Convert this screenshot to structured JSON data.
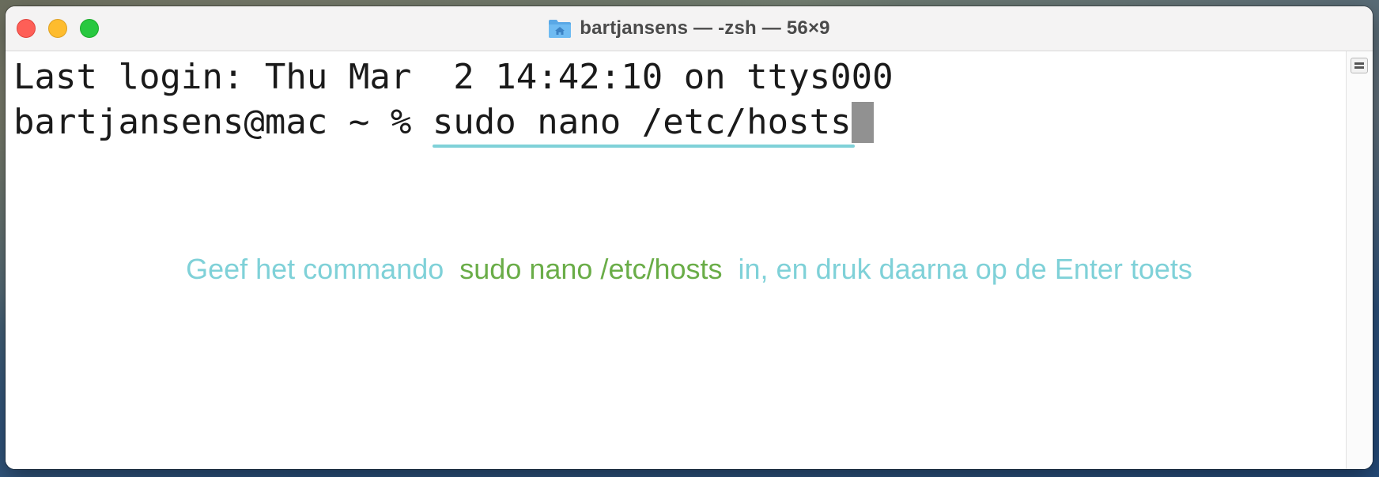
{
  "window": {
    "title": "bartjansens — -zsh — 56×9",
    "title_icon": "home-folder-icon"
  },
  "terminal": {
    "line1": "Last login: Thu Mar  2 14:42:10 on ttys000",
    "prompt": "bartjansens@mac ~ % ",
    "command": "sudo nano /etc/hosts"
  },
  "annotation": {
    "part_a": "Geef het commando",
    "part_b": "sudo nano /etc/hosts",
    "part_c": "in, en druk daarna op de Enter toets"
  },
  "colors": {
    "close": "#fe5f57",
    "minimize": "#febc2e",
    "zoom": "#28c840",
    "underline": "#7fd1d8",
    "annotation_text": "#7fd1d8",
    "annotation_command": "#6aad48",
    "cursor": "#919191"
  }
}
